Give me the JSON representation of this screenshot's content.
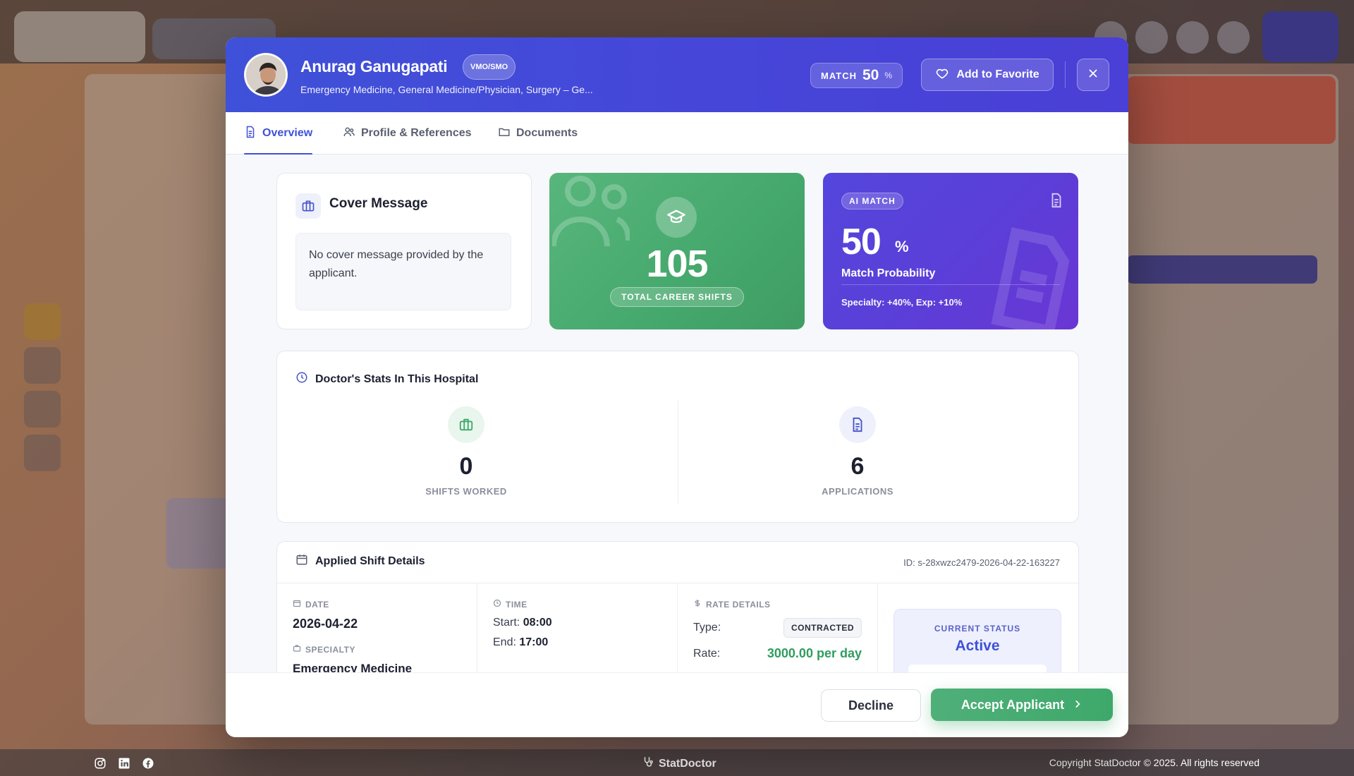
{
  "background": {
    "colors": {
      "accent": "#3f51d8",
      "success": "#3ea86a",
      "ai": "#5a3fd8"
    }
  },
  "footer": {
    "social_icons": [
      "instagram-icon",
      "linkedin-icon",
      "facebook-icon"
    ],
    "brand": "StatDoctor",
    "copyright": "Copyright StatDoctor © 2025. All rights reserved"
  },
  "applicant": {
    "name": "Anurag Ganugapati",
    "role_badge": "VMO/SMO",
    "specialties": "Emergency Medicine, General Medicine/Physician, Surgery – Ge...",
    "match_label": "MATCH",
    "match_value": "50",
    "match_unit": "%",
    "favorite_label": "Add to Favorite"
  },
  "tabs": [
    {
      "label": "Overview",
      "icon": "document-icon",
      "active": true
    },
    {
      "label": "Profile & References",
      "icon": "users-icon",
      "active": false
    },
    {
      "label": "Documents",
      "icon": "folder-icon",
      "active": false
    }
  ],
  "cover": {
    "title": "Cover Message",
    "message": "No cover message provided by the applicant."
  },
  "career": {
    "value": "105",
    "label": "TOTAL CAREER SHIFTS"
  },
  "ai_match": {
    "badge": "AI MATCH",
    "value": "50",
    "unit": "%",
    "label": "Match Probability",
    "breakdown": "Specialty: +40%, Exp: +10%"
  },
  "hospital_stats": {
    "title": "Doctor's Stats In This Hospital",
    "shifts_worked": {
      "value": "0",
      "label": "SHIFTS WORKED"
    },
    "applications": {
      "value": "6",
      "label": "APPLICATIONS"
    }
  },
  "shift": {
    "title": "Applied Shift Details",
    "id": "ID: s-28xwzc2479-2026-04-22-163227",
    "date_label": "DATE",
    "date": "2026-04-22",
    "specialty_label": "SPECIALTY",
    "specialty": "Emergency Medicine",
    "time_label": "TIME",
    "start_label": "Start:",
    "start": "08:00",
    "end_label": "End:",
    "end": "17:00",
    "rate_label": "RATE DETAILS",
    "type_label": "Type:",
    "type": "CONTRACTED",
    "rate_row_label": "Rate:",
    "rate": "3000.00 per day",
    "status_label": "CURRENT STATUS",
    "status": "Active"
  },
  "actions": {
    "decline": "Decline",
    "accept": "Accept Applicant"
  }
}
